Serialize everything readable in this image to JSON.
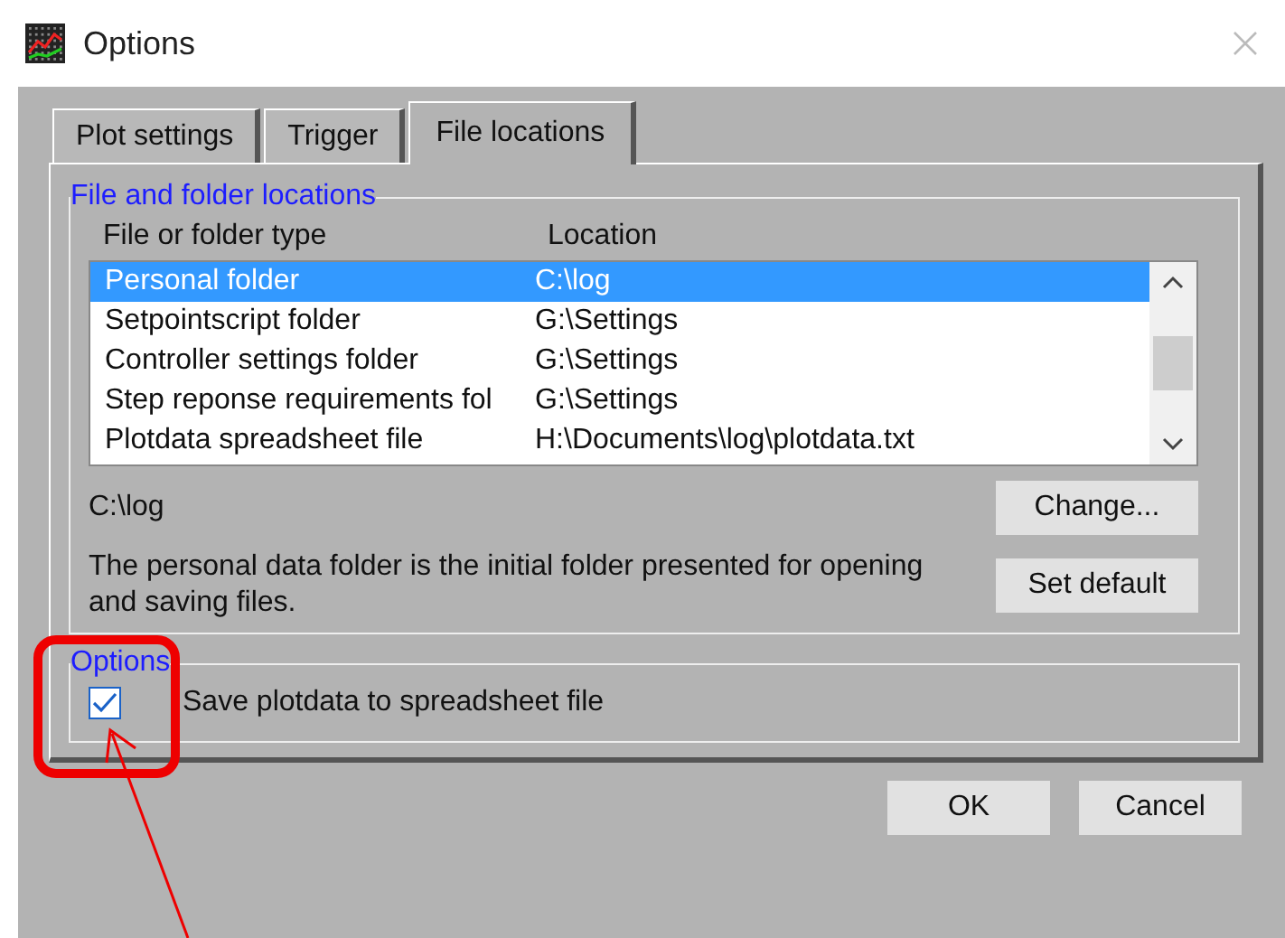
{
  "window": {
    "title": "Options"
  },
  "tabs": [
    {
      "label": "Plot settings",
      "selected": false
    },
    {
      "label": "Trigger",
      "selected": false
    },
    {
      "label": "File locations",
      "selected": true
    }
  ],
  "locations_group": {
    "title": "File and folder locations",
    "columns": [
      "File or folder type",
      "Location"
    ],
    "rows": [
      {
        "type": "Personal folder",
        "location": "C:\\log",
        "selected": true
      },
      {
        "type": "Setpointscript folder",
        "location": "G:\\Settings",
        "selected": false
      },
      {
        "type": "Controller settings folder",
        "location": "G:\\Settings",
        "selected": false
      },
      {
        "type": "Step reponse requirements fol",
        "location": "G:\\Settings",
        "selected": false
      },
      {
        "type": "Plotdata spreadsheet file",
        "location": "H:\\Documents\\log\\plotdata.txt",
        "selected": false
      }
    ],
    "current_path": "C:\\log",
    "change_button": "Change...",
    "description": "The personal data folder is the initial folder presented for opening and saving files.",
    "default_button": "Set default"
  },
  "options_group": {
    "title": "Options",
    "checkboxes": [
      {
        "label": "Save plotdata to spreadsheet file",
        "checked": true
      }
    ]
  },
  "buttons": [
    "OK",
    "Cancel"
  ]
}
